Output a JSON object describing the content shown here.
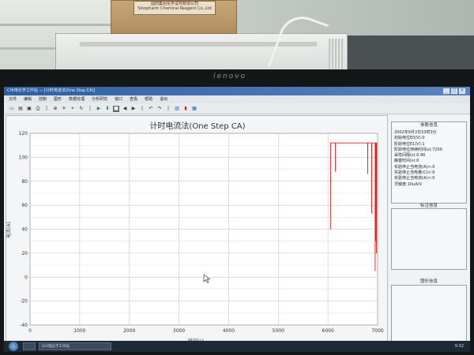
{
  "room": {
    "box_label_line1": "国药集团化学试剂有限公司",
    "box_label_line2": "Sinopharm Chemical Reagent Co.,Ltd",
    "monitor_brand": "lenovo"
  },
  "app": {
    "title": "CHI电化学工作站 — [计时电流法(One Step CA)]",
    "window_controls": [
      "_",
      "□",
      "×"
    ],
    "menu": [
      "文件",
      "编辑",
      "控制",
      "图形",
      "数据处理",
      "分析研究",
      "窗口",
      "查看",
      "帮助",
      "退出"
    ],
    "toolbar_icons": [
      "new-icon",
      "open-icon",
      "save-icon",
      "print-icon",
      "separator",
      "zoom-icon",
      "pointer-icon",
      "measure-icon",
      "rotate-icon",
      "separator",
      "run-icon",
      "pause-icon",
      "stop-icon",
      "back-icon",
      "forward-icon",
      "separator",
      "undo-icon",
      "redo-icon",
      "separator",
      "chart-icon",
      "color-icon",
      "grid-icon"
    ]
  },
  "chart_data": {
    "type": "line",
    "title": "计时电流法(One Step CA)",
    "xlabel": "时间(s)",
    "ylabel": "电流(A)",
    "xlim": [
      0,
      7000
    ],
    "ylim": [
      -40,
      120
    ],
    "x_ticks": [
      0,
      1000,
      2000,
      3000,
      4000,
      5000,
      6000,
      7000
    ],
    "y_ticks": [
      -40,
      -20,
      0,
      20,
      40,
      60,
      80,
      100,
      120
    ],
    "grid": true,
    "series": [
      {
        "color": "#d42020",
        "x": [
          6050,
          6051,
          6052,
          6150,
          6151,
          6152,
          6800,
          6801,
          6802,
          6880,
          6881,
          6882,
          6950,
          6951,
          6952,
          6960,
          6961,
          6970,
          6975,
          6980,
          6990
        ],
        "y": [
          112,
          40,
          112,
          112,
          88,
          112,
          112,
          86,
          112,
          112,
          53,
          112,
          112,
          5,
          112,
          112,
          30,
          112,
          20,
          112,
          112
        ]
      }
    ]
  },
  "side_panel": {
    "params_title": "参数信息",
    "params": [
      "2002年9月3日10时3分",
      "初始电位E0(V):0",
      "阶跃电位E1(V):1",
      "阶跃电位持续时间(s):7200",
      "采样间隔(s):0.40",
      "静置时间(s):0",
      "实验停止当电流(A)>:0",
      "实验停止当电量(C)>:0",
      "实验停止当电流(A)<:0",
      "灵敏度:10uA/V"
    ],
    "label_title": "标注信息",
    "figure_title": "图形信息"
  },
  "taskbar": {
    "tasks": [
      "CHI电化学工作站",
      ""
    ],
    "tray": "9:32"
  }
}
